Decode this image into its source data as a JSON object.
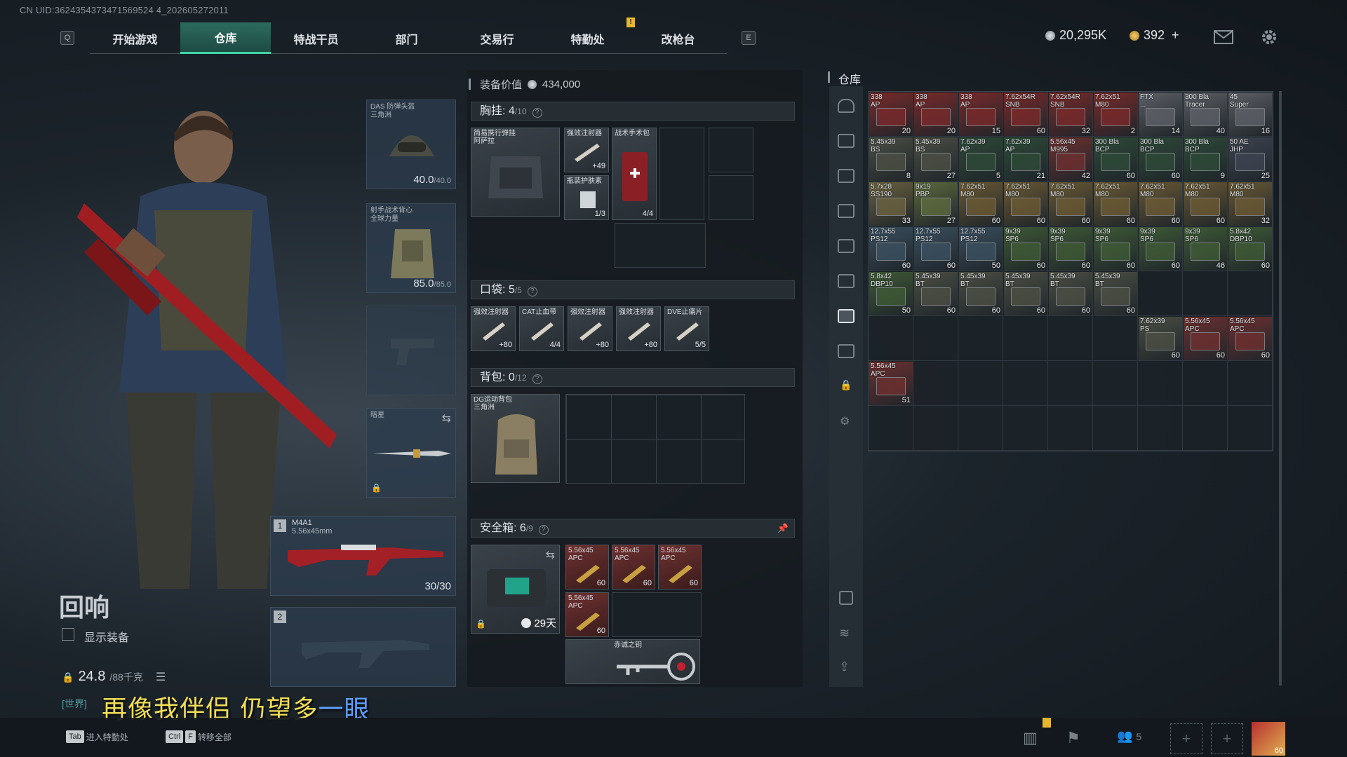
{
  "uid": "CN UID:3624354373471569524 4_202605272011",
  "nav": {
    "left_key": "Q",
    "right_key": "E",
    "tabs": [
      "开始游戏",
      "仓库",
      "特战干员",
      "部门",
      "交易行",
      "特勤处",
      "改枪台"
    ],
    "active": "仓库",
    "mark": "!"
  },
  "currency": {
    "silver": "20,295K",
    "gold": "392",
    "plus": "+"
  },
  "operator": {
    "name": "回响",
    "show_equipment": "显示装备",
    "weight": "24.8",
    "weight_max": "/88千克",
    "chat_prefix": "[世界]"
  },
  "slots": {
    "helmet": {
      "label": "DAS 防弹头盔\n三角洲",
      "value": "40.0",
      "max": "/40.0"
    },
    "armor": {
      "label": "射手战术背心\n全球力量",
      "value": "85.0",
      "max": "/85.0"
    },
    "melee": {
      "label": "暗星"
    },
    "primary": {
      "index": "1",
      "name": "M4A1",
      "caliber": "5.56x45mm",
      "ammo": "30/30"
    },
    "secondary": {
      "index": "2"
    }
  },
  "mid": {
    "value_label": "装备价值",
    "value": "434,000",
    "chest": {
      "label": "胸挂:",
      "count": "4",
      "cap": "/10",
      "items": [
        {
          "name": "简易携行弹挂\n阿萨拉",
          "count": ""
        },
        {
          "name": "强效注射器",
          "count": "+49"
        },
        {
          "name": "瓶装护肤素",
          "count": "1/3"
        },
        {
          "name": "战术手术包",
          "count": "4/4"
        }
      ]
    },
    "pocket": {
      "label": "口袋:",
      "count": "5",
      "cap": "/5",
      "items": [
        {
          "name": "强效注射器",
          "count": "+80"
        },
        {
          "name": "CAT止血带",
          "count": "4/4"
        },
        {
          "name": "强效注射器",
          "count": "+80"
        },
        {
          "name": "强效注射器",
          "count": "+80"
        },
        {
          "name": "DVE止痛片",
          "count": "5/5"
        }
      ]
    },
    "backpack": {
      "label": "背包:",
      "count": "0",
      "cap": "/12",
      "item": "DG运动背包\n三角洲"
    },
    "safebox": {
      "label": "安全箱:",
      "count": "6",
      "cap": "/9",
      "timer": "29天",
      "items": [
        {
          "name": "5.56x45\nAPC",
          "count": "60"
        },
        {
          "name": "5.56x45\nAPC",
          "count": "60"
        },
        {
          "name": "5.56x45\nAPC",
          "count": "60"
        },
        {
          "name": "5.56x45\nAPC",
          "count": "60"
        }
      ],
      "key": "赤诚之钥"
    }
  },
  "warehouse": {
    "title": "仓库",
    "rows": [
      [
        {
          "n": "338\nAP",
          "c": "20",
          "col": "#7a2a2a"
        },
        {
          "n": "338\nAP",
          "c": "20",
          "col": "#7a2a2a"
        },
        {
          "n": "338\nAP",
          "c": "15",
          "col": "#7a2a2a"
        },
        {
          "n": "7.62x54R\nSNB",
          "c": "60",
          "col": "#7a2a2a"
        },
        {
          "n": "7.62x54R\nSNB",
          "c": "32",
          "col": "#7a2a2a"
        },
        {
          "n": "7.62x51\nM80",
          "c": "2",
          "col": "#7a2a2a"
        },
        {
          "n": "FTX\n...",
          "c": "14",
          "col": "#5d6066"
        },
        {
          "n": "300 Bla\nTracer",
          "c": "40",
          "col": "#5d6066"
        },
        {
          "n": "45\nSuper",
          "c": "16",
          "col": "#5d6066"
        }
      ],
      [
        {
          "n": "5.45x39\nBS",
          "c": "8",
          "col": "#4c4f44"
        },
        {
          "n": "5.45x39\nBS",
          "c": "27",
          "col": "#4c4f44"
        },
        {
          "n": "7.62x39\nAP",
          "c": "5",
          "col": "#2e4a38"
        },
        {
          "n": "7.62x39\nAP",
          "c": "21",
          "col": "#2e4a38"
        },
        {
          "n": "5.56x45\nM995",
          "c": "42",
          "col": "#6e3030"
        },
        {
          "n": "300 Bla\nBCP",
          "c": "60",
          "col": "#2e4a38"
        },
        {
          "n": "300 Bla\nBCP",
          "c": "60",
          "col": "#2e4a38"
        },
        {
          "n": "300 Bla\nBCP",
          "c": "9",
          "col": "#2e4a38"
        },
        {
          "n": "50 AE\nJHP",
          "c": "25",
          "col": "#3e4450"
        }
      ],
      [
        {
          "n": "5.7x28\nSS190",
          "c": "33",
          "col": "#6b6240"
        },
        {
          "n": "9x19\nPBP",
          "c": "27",
          "col": "#5d6a3e"
        },
        {
          "n": "7.62x51\nM80",
          "c": "60",
          "col": "#6b5a34"
        },
        {
          "n": "7.62x51\nM80",
          "c": "60",
          "col": "#6b5a34"
        },
        {
          "n": "7.62x51\nM80",
          "c": "60",
          "col": "#6b5a34"
        },
        {
          "n": "7.62x51\nM80",
          "c": "60",
          "col": "#6b5a34"
        },
        {
          "n": "7.62x51\nM80",
          "c": "60",
          "col": "#6b5a34"
        },
        {
          "n": "7.62x51\nM80",
          "c": "60",
          "col": "#6b5a34"
        },
        {
          "n": "7.62x51\nM80",
          "c": "32",
          "col": "#6b5a34"
        }
      ],
      [
        {
          "n": "12.7x55\nPS12",
          "c": "60",
          "col": "#3b5060"
        },
        {
          "n": "12.7x55\nPS12",
          "c": "60",
          "col": "#3b5060"
        },
        {
          "n": "12.7x55\nPS12",
          "c": "50",
          "col": "#3b5060"
        },
        {
          "n": "9x39\nSP6",
          "c": "60",
          "col": "#3f5a36"
        },
        {
          "n": "9x39\nSP6",
          "c": "60",
          "col": "#3f5a36"
        },
        {
          "n": "9x39\nSP6",
          "c": "60",
          "col": "#3f5a36"
        },
        {
          "n": "9x39\nSP6",
          "c": "60",
          "col": "#3f5a36"
        },
        {
          "n": "9x39\nSP6",
          "c": "46",
          "col": "#3f5a36"
        },
        {
          "n": "5.8x42\nDBP10",
          "c": "60",
          "col": "#3f5a36"
        }
      ],
      [
        {
          "n": "5.8x42\nDBP10",
          "c": "50",
          "col": "#3f5a36"
        },
        {
          "n": "5.45x39\nBT",
          "c": "60",
          "col": "#4c4f44"
        },
        {
          "n": "5.45x39\nBT",
          "c": "60",
          "col": "#4c4f44"
        },
        {
          "n": "5.45x39\nBT",
          "c": "60",
          "col": "#4c4f44"
        },
        {
          "n": "5.45x39\nBT",
          "c": "60",
          "col": "#4c4f44"
        },
        {
          "n": "5.45x39\nBT",
          "c": "60",
          "col": "#4c4f44"
        },
        null,
        null,
        null
      ],
      [
        null,
        null,
        null,
        null,
        null,
        null,
        {
          "n": "7.62x39\nPS",
          "c": "60",
          "col": "#4c4f44"
        },
        {
          "n": "5.56x45\nAPC",
          "c": "60",
          "col": "#6e3030"
        },
        {
          "n": "5.56x45\nAPC",
          "c": "60",
          "col": "#6e3030"
        }
      ],
      [
        {
          "n": "5.56x45\nAPC",
          "c": "51",
          "col": "#6e3030"
        },
        null,
        null,
        null,
        null,
        null,
        null,
        null,
        null
      ]
    ]
  },
  "subtitle": {
    "main": "再像我伴侣 仍望多",
    "highlight": "一眼"
  },
  "bottom": {
    "hint1_key": "Tab",
    "hint1": "进入特勤处",
    "hint2_key1": "Ctrl",
    "hint2_key2": "F",
    "hint2": "转移全部",
    "squad_count": "5",
    "avatar_count": "60"
  },
  "colors": {
    "accent": "#3fd3a8",
    "alert": "#e6b62c"
  }
}
